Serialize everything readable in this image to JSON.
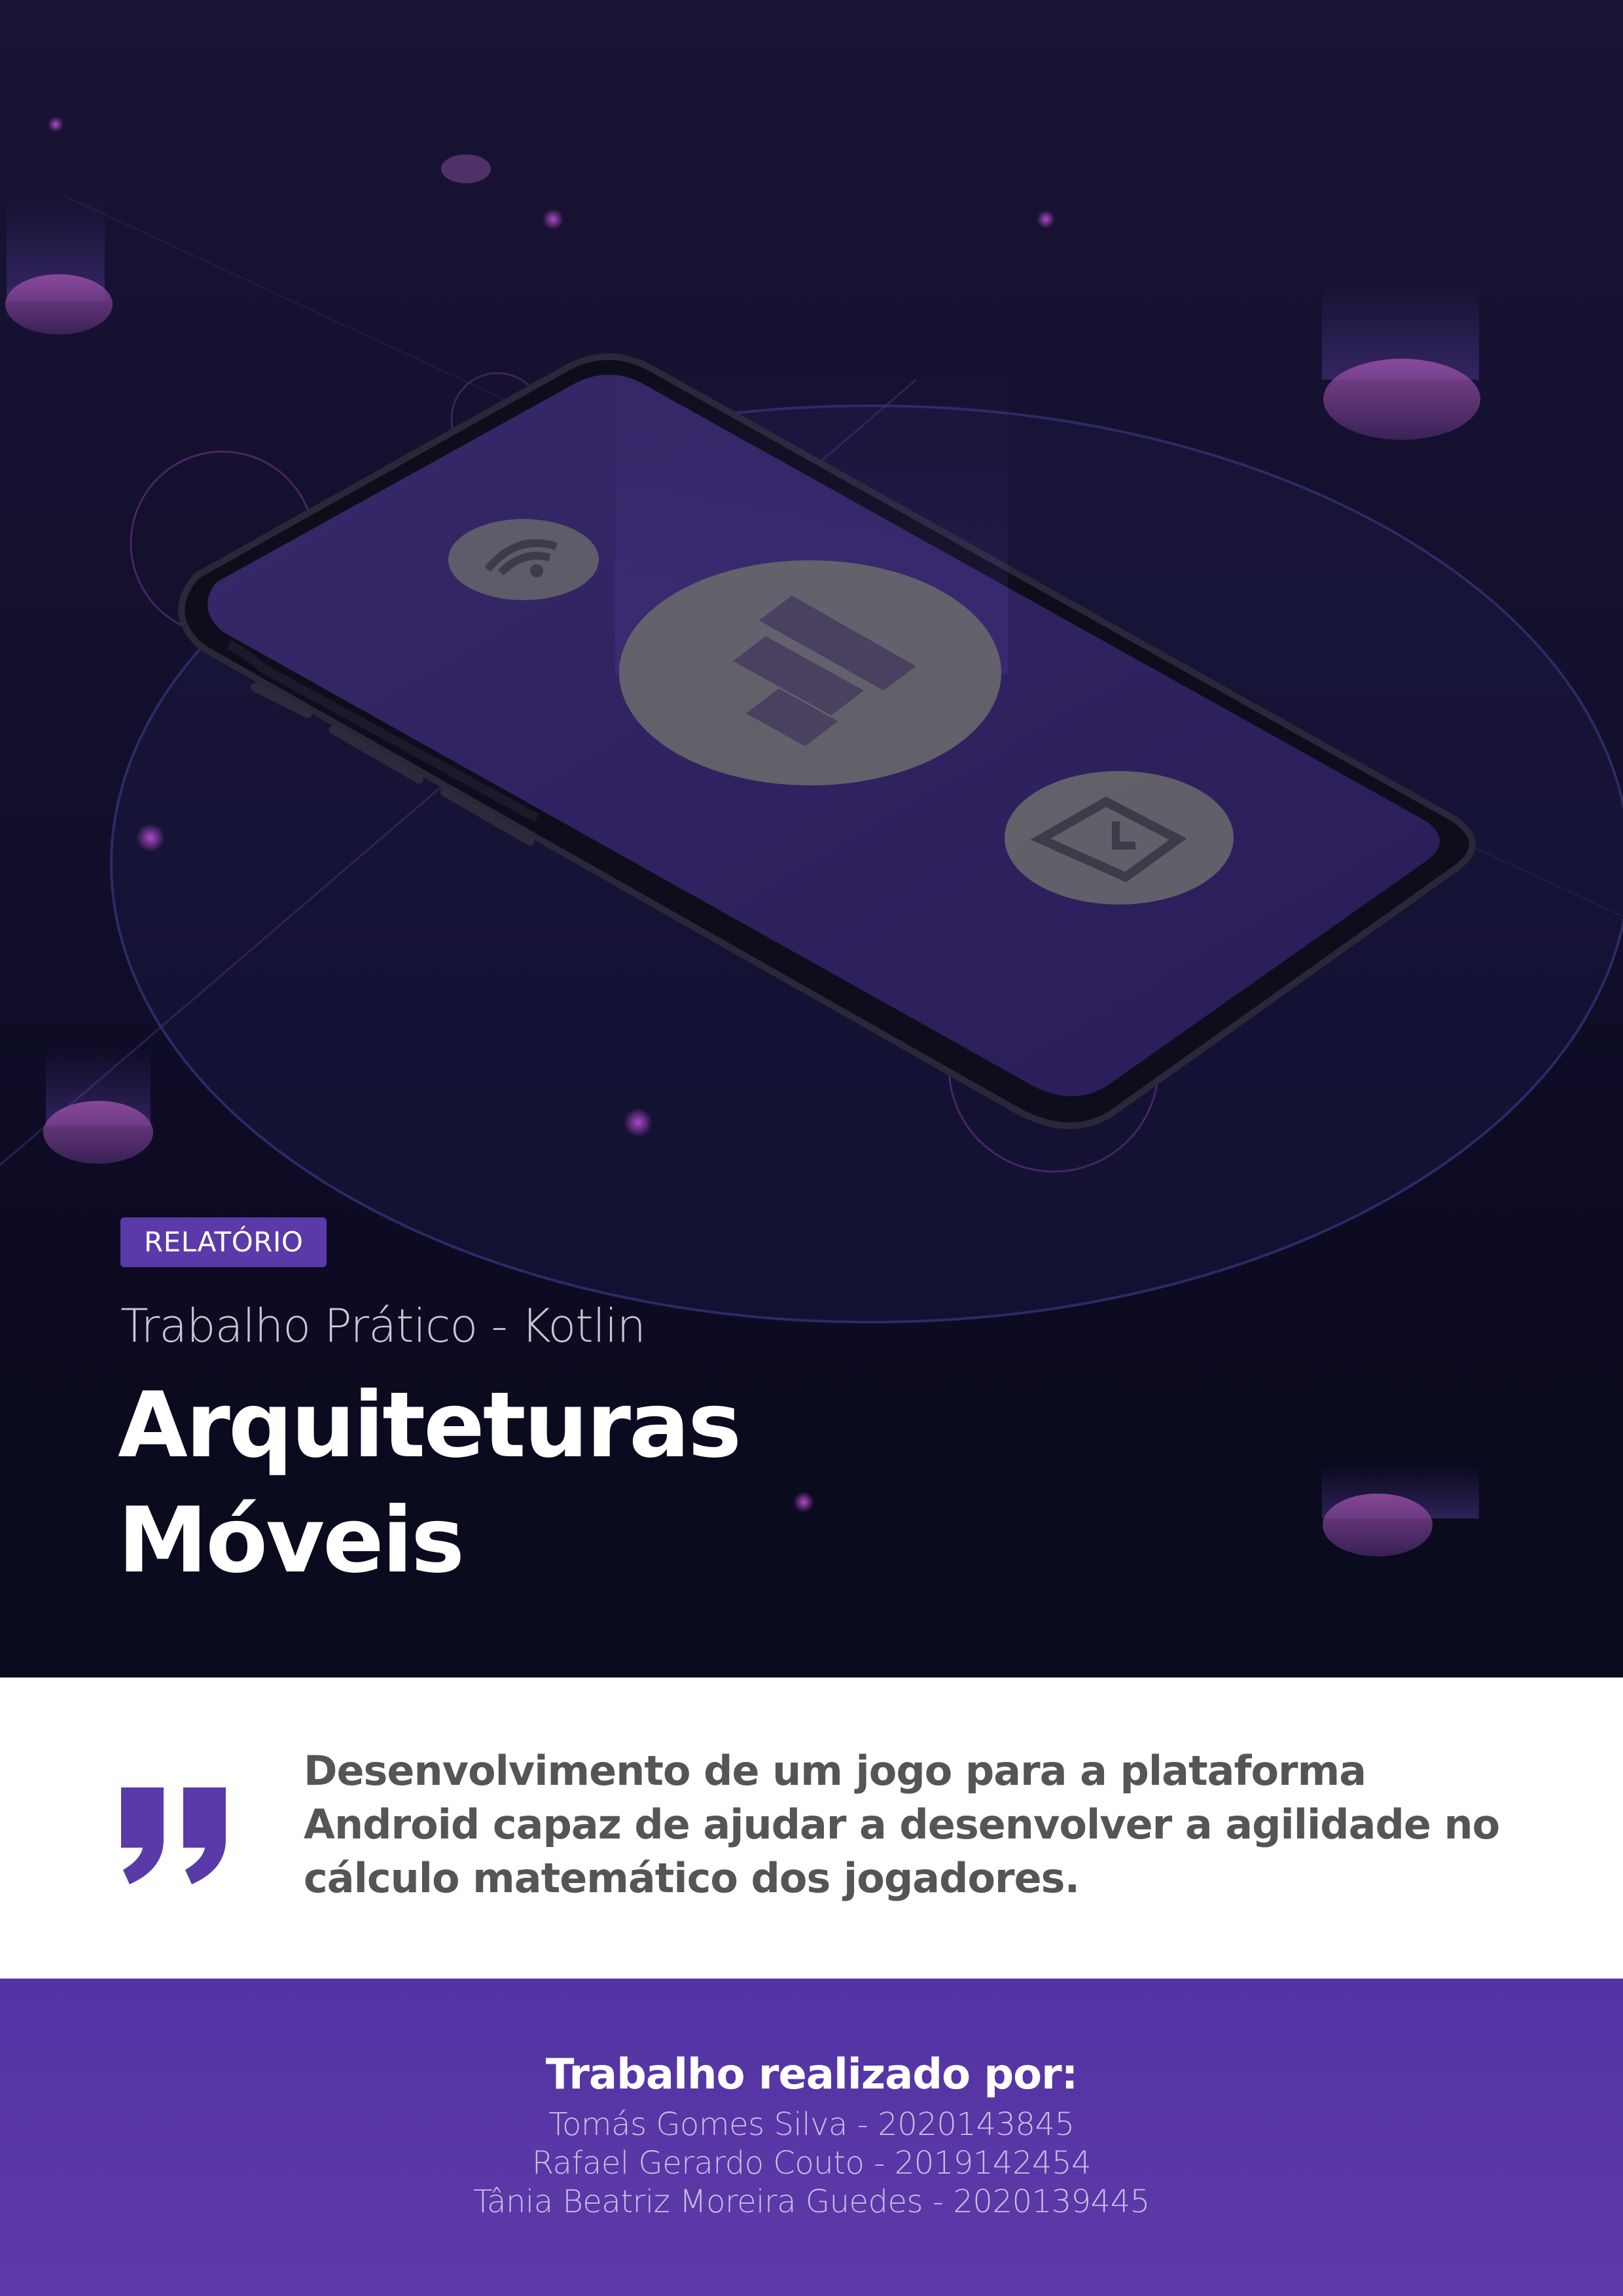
{
  "cover": {
    "badge": "RELATÓRIO",
    "subtitle": "Trabalho Prático - Kotlin",
    "title_lines": [
      "Arquiteturas",
      "Móveis"
    ],
    "illustration_icons": [
      "wifi-icon",
      "app-logo-icon",
      "shield-icon"
    ]
  },
  "quote": {
    "icon": "quote-icon",
    "text": "Desenvolvimento de um jogo para a plataforma Android capaz de ajudar a desenvolver a agilidade no cálculo matemático dos jogadores."
  },
  "footer": {
    "heading": "Trabalho realizado por:",
    "authors": [
      "Tomás Gomes Silva - 2020143845",
      "Rafael Gerardo Couto - 2019142454",
      "Tânia Beatriz Moreira Guedes - 2020139445"
    ]
  },
  "colors": {
    "hero_bg": "#120f2c",
    "accent": "#5a3aa8",
    "footer_bg": "#5437a5",
    "quote_text": "#555555"
  }
}
